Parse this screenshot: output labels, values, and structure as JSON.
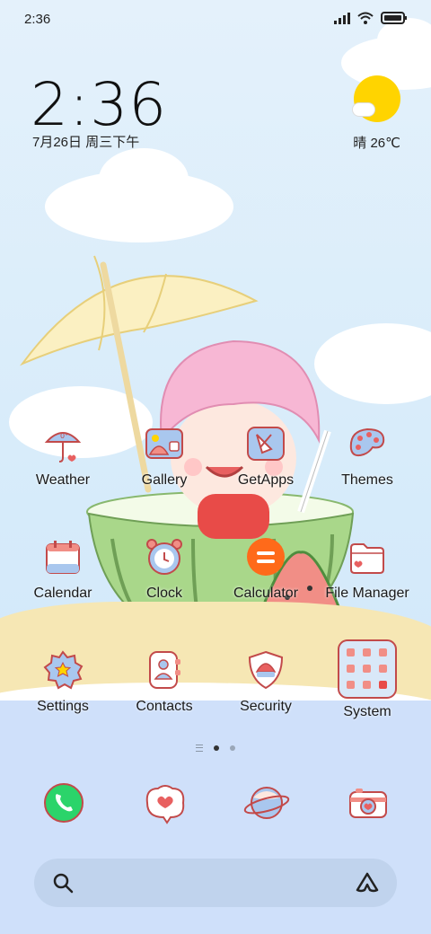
{
  "status_bar": {
    "time": "2:36",
    "icons": [
      "signal-icon",
      "wifi-icon",
      "battery-icon"
    ]
  },
  "clock_widget": {
    "time": "2:36",
    "date": "7月26日 周三下午"
  },
  "weather_widget": {
    "condition_icon": "sun-cloud-icon",
    "text": "晴 26℃"
  },
  "apps": [
    {
      "label": "Weather",
      "icon": "umbrella-icon"
    },
    {
      "label": "Gallery",
      "icon": "gallery-icon"
    },
    {
      "label": "GetApps",
      "icon": "getapps-icon"
    },
    {
      "label": "Themes",
      "icon": "palette-icon"
    },
    {
      "label": "Calendar",
      "icon": "calendar-icon"
    },
    {
      "label": "Clock",
      "icon": "alarm-clock-icon"
    },
    {
      "label": "Calculator",
      "icon": "calculator-icon"
    },
    {
      "label": "File Manager",
      "icon": "folder-icon"
    },
    {
      "label": "Settings",
      "icon": "gear-icon"
    },
    {
      "label": "Contacts",
      "icon": "contacts-icon"
    },
    {
      "label": "Security",
      "icon": "shield-icon"
    },
    {
      "label": "System",
      "icon": "folder-grid-icon"
    }
  ],
  "page_indicator": {
    "pages": 2,
    "current": 1
  },
  "dock": [
    {
      "icon": "phone-icon"
    },
    {
      "icon": "messages-icon"
    },
    {
      "icon": "browser-planet-icon"
    },
    {
      "icon": "camera-icon"
    }
  ],
  "search_bar": {
    "left_icon": "search-icon",
    "right_icon": "assistant-icon"
  },
  "colors": {
    "sky": "#e4f1fb",
    "sun": "#ffd400",
    "calculator_orange": "#ff6a1a",
    "phone_green": "#2bd46a",
    "icon_outline": "#c24a4a",
    "icon_blue": "#a9c7ee"
  }
}
